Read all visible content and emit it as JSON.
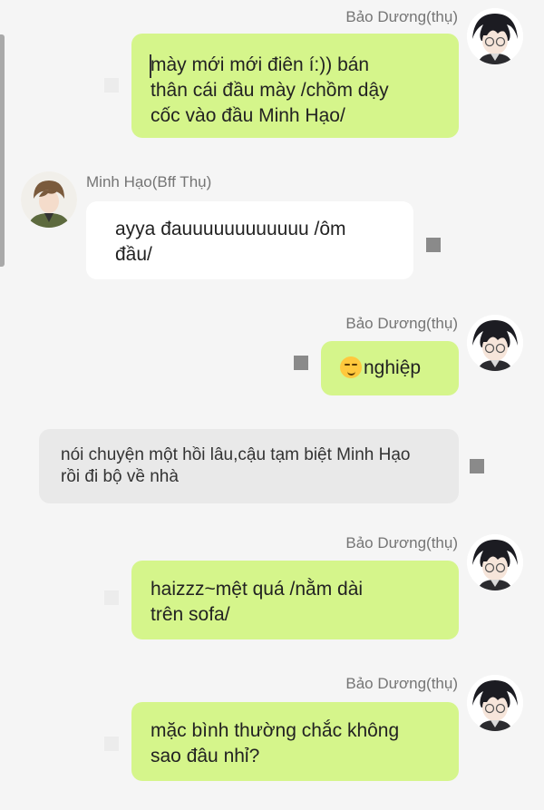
{
  "messages": [
    {
      "sender": "Bảo Dương(thụ)",
      "lines": [
        "mày mới mới điên í:)) bán",
        "thân cái đầu mày /chồm dậy",
        "cốc vào đầu Minh Hạo/"
      ]
    },
    {
      "sender": "Minh Hạo(Bff Thụ)",
      "lines": [
        "ayya đauuuuuuuuuuuu /ôm",
        "đầu/"
      ]
    },
    {
      "sender": "Bảo Dương(thụ)",
      "text": "nghiệp",
      "emoji": "smirking-face"
    },
    {
      "lines": [
        "nói chuyện một hồi lâu,cậu tạm biệt Minh Hạo",
        "rồi đi bộ về nhà"
      ]
    },
    {
      "sender": "Bảo Dương(thụ)",
      "lines": [
        "haizzz~mệt quá /nằm dài",
        "trên sofa/"
      ]
    },
    {
      "sender": "Bảo Dương(thụ)",
      "lines": [
        "mặc bình thường chắc không",
        "sao đâu nhỉ?"
      ]
    }
  ],
  "colors": {
    "own_bubble": "#d5f58b",
    "other_bubble": "#ffffff",
    "narration_bubble": "#e9e9e9",
    "background": "#f5f5f5"
  },
  "icons": {
    "bao_duong_avatar": "dark-haired-boy-with-glasses-avatar",
    "minh_hao_avatar": "brown-haired-boy-avatar"
  }
}
